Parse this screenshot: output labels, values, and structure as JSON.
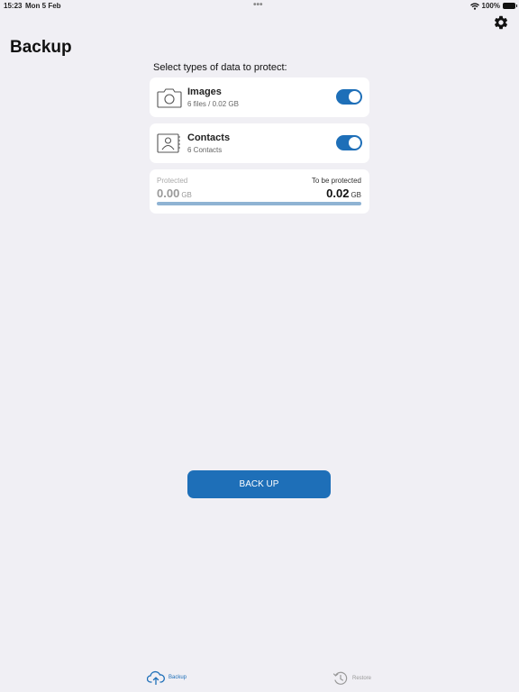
{
  "status_bar": {
    "time": "15:23",
    "date": "Mon 5 Feb",
    "dots": "•••",
    "battery_percent": "100%"
  },
  "header": {
    "title": "Backup",
    "settings_icon": "gear-icon"
  },
  "section_label": "Select types of data to protect:",
  "data_types": [
    {
      "title": "Images",
      "subtitle": "6 files / 0.02 GB",
      "icon": "camera-icon",
      "enabled": true
    },
    {
      "title": "Contacts",
      "subtitle": "6 Contacts",
      "icon": "contact-book-icon",
      "enabled": true
    }
  ],
  "progress": {
    "protected_label": "Protected",
    "protected_value": "0.00",
    "protected_unit": "GB",
    "to_be_label": "To be protected",
    "to_be_value": "0.02",
    "to_be_unit": "GB",
    "fraction_protected": 0
  },
  "primary_action": {
    "label": "BACK UP"
  },
  "tabs": [
    {
      "label": "Backup",
      "icon": "cloud-upload-icon",
      "active": true
    },
    {
      "label": "Restore",
      "icon": "history-icon",
      "active": false
    }
  ],
  "colors": {
    "accent": "#1e6fb8",
    "background": "#f0eff4",
    "progress_track": "#8fb3d3"
  }
}
